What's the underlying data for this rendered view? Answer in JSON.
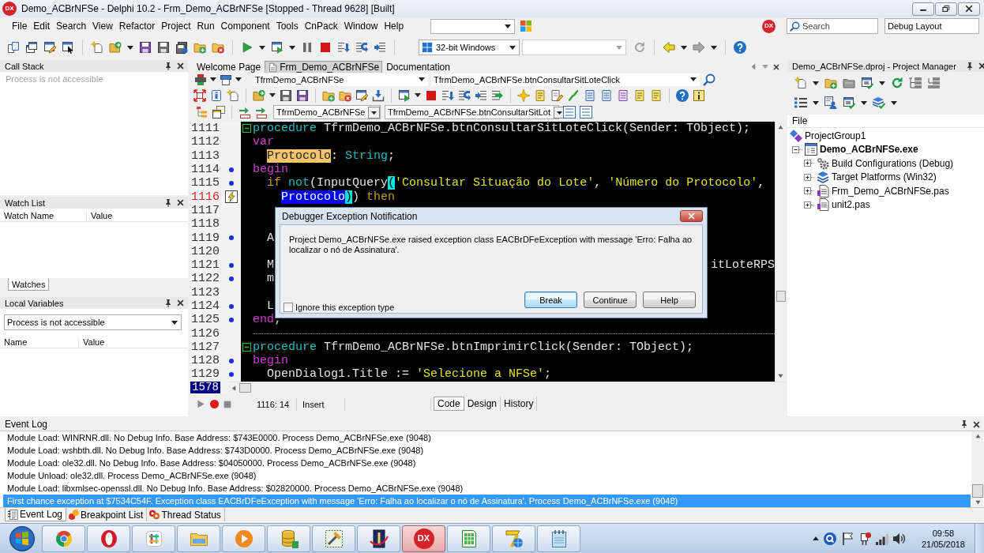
{
  "title_bar": {
    "logo": "DX",
    "title": "Demo_ACBrNFSe - Delphi 10.2 - Frm_Demo_ACBrNFSe [Stopped - Thread 9628] [Built]"
  },
  "menu_bar": {
    "items": [
      "File",
      "Edit",
      "Search",
      "View",
      "Refactor",
      "Project",
      "Run",
      "Component",
      "Tools",
      "CnPack",
      "Window",
      "Help"
    ],
    "logo": "DX",
    "search": {
      "placeholder": "Search"
    },
    "layout": "Debug Layout"
  },
  "toolbar": {
    "platform": "32-bit Windows"
  },
  "call_stack": {
    "title": "Call Stack",
    "message": "Process is not accessible"
  },
  "watch_list": {
    "title": "Watch List",
    "columns": [
      "Watch Name",
      "Value"
    ],
    "tabs": [
      {
        "label": "Watches",
        "selected": true
      }
    ]
  },
  "local_variables": {
    "title": "Local Variables",
    "process": "Process is not accessible",
    "columns": [
      "Name",
      "Value"
    ]
  },
  "editor": {
    "tabs": [
      {
        "label": "Welcome Page",
        "selected": false
      },
      {
        "label": "Frm_Demo_ACBrNFSe",
        "selected": true
      },
      {
        "label": "Documentation",
        "selected": false
      }
    ],
    "class_box": "TfrmDemo_ACBrNFSe",
    "method_box": "TfrmDemo_ACBrNFSe.btnConsultarSitLoteClick",
    "unit_class_box": "TfrmDemo_ACBrNFSe",
    "unit_method_box": "TfrmDemo_ACBrNFSe.btnConsultarSitLot",
    "lines": [
      {
        "number": "1111",
        "kind": "code",
        "fold": true,
        "dot": false,
        "error": false,
        "segments": [
          [
            {
              "text": "procedure",
              "kind": "reserved"
            },
            {
              "text": " TfrmDemo_ACBrNFSe.btnConsultarSitLoteClick(Sender: TObject);",
              "kind": "plain"
            }
          ]
        ]
      },
      {
        "number": "1112",
        "kind": "code",
        "fold": false,
        "dot": false,
        "error": false,
        "segments": [
          [
            {
              "text": "var",
              "kind": "block"
            }
          ]
        ]
      },
      {
        "number": "1113",
        "kind": "code",
        "fold": false,
        "dot": false,
        "error": false,
        "segments": [
          [
            {
              "text": "  Protocolo",
              "kind": "highlight"
            },
            {
              "text": ": ",
              "kind": "plain"
            },
            {
              "text": "String",
              "kind": "reserved"
            },
            {
              "text": ";",
              "kind": "plain"
            }
          ]
        ]
      },
      {
        "number": "1114",
        "kind": "code",
        "fold": false,
        "dot": true,
        "error": false,
        "segments": [
          [
            {
              "text": "begin",
              "kind": "block"
            }
          ]
        ]
      },
      {
        "number": "1115",
        "kind": "code",
        "fold": false,
        "dot": true,
        "error": false,
        "segments": [
          [
            {
              "text": "  if",
              "kind": "control"
            },
            {
              "text": " not",
              "kind": "reserved"
            },
            {
              "text": "(InputQuery",
              "kind": "plain"
            },
            {
              "text": "(",
              "kind": "brace"
            },
            {
              "text": "'Consultar Situação do Lote'",
              "kind": "string"
            },
            {
              "text": ", ",
              "kind": "plain"
            },
            {
              "text": "'Número do Protocolo'",
              "kind": "string"
            },
            {
              "text": ",",
              "kind": "plain"
            }
          ]
        ]
      },
      {
        "number": "1116",
        "kind": "code",
        "fold": false,
        "dot": false,
        "error": true,
        "segments": [
          [
            {
              "text": "    Protocolo",
              "kind": "selected"
            },
            {
              "text": ")",
              "kind": "brace"
            },
            {
              "text": ")",
              "kind": "plain"
            },
            {
              "text": " then",
              "kind": "control"
            }
          ]
        ]
      },
      {
        "number": "1117",
        "kind": "code",
        "fold": false,
        "dot": false,
        "error": false
      },
      {
        "number": "1118",
        "kind": "code",
        "fold": false,
        "dot": false,
        "error": false
      },
      {
        "number": "1119",
        "kind": "code",
        "fold": false,
        "dot": true,
        "error": false,
        "segments": [
          [
            {
              "text": "  A",
              "kind": "plain"
            }
          ]
        ]
      },
      {
        "number": "1120",
        "kind": "code",
        "fold": false,
        "dot": false,
        "error": false
      },
      {
        "number": "1121",
        "kind": "code",
        "fold": false,
        "dot": true,
        "error": false,
        "segments": [
          [
            {
              "text": "  M",
              "kind": "plain"
            }
          ],
          [
            {
              "text": "itLoteRPS",
              "kind": "plain"
            }
          ]
        ]
      },
      {
        "number": "1122",
        "kind": "code",
        "fold": false,
        "dot": true,
        "error": false,
        "segments": [
          [
            {
              "text": "  m",
              "kind": "plain"
            }
          ]
        ]
      },
      {
        "number": "1123",
        "kind": "code",
        "fold": false,
        "dot": false,
        "error": false
      },
      {
        "number": "1124",
        "kind": "code",
        "fold": false,
        "dot": true,
        "error": false,
        "segments": [
          [
            {
              "text": "  L",
              "kind": "plain"
            }
          ]
        ]
      },
      {
        "number": "1125",
        "kind": "code",
        "fold": false,
        "dot": true,
        "error": false,
        "segments": [
          [
            {
              "text": "end",
              "kind": "block"
            },
            {
              "text": ";",
              "kind": "plain"
            }
          ]
        ]
      },
      {
        "number": "1126",
        "kind": "separator",
        "fold": false,
        "dot": false,
        "error": false
      },
      {
        "number": "1127",
        "kind": "code",
        "fold": true,
        "dot": false,
        "error": false,
        "segments": [
          [
            {
              "text": "procedure",
              "kind": "reserved"
            },
            {
              "text": " TfrmDemo_ACBrNFSe.btnImprimirClick(Sender: TObject);",
              "kind": "plain"
            }
          ]
        ]
      },
      {
        "number": "1128",
        "kind": "code",
        "fold": false,
        "dot": true,
        "error": false,
        "segments": [
          [
            {
              "text": "begin",
              "kind": "block"
            }
          ]
        ]
      },
      {
        "number": "1129",
        "kind": "code",
        "fold": false,
        "dot": true,
        "error": false,
        "segments": [
          [
            {
              "text": "  OpenDialog1.Title := ",
              "kind": "plain"
            },
            {
              "text": "'Selecione a NFSe'",
              "kind": "string"
            },
            {
              "text": ";",
              "kind": "plain"
            }
          ]
        ]
      }
    ],
    "line_count": "1578",
    "cursor": "1116: 14",
    "mode": "Insert",
    "view_tabs": [
      {
        "label": "Code",
        "selected": true
      },
      {
        "label": "Design",
        "selected": false
      },
      {
        "label": "History",
        "selected": false
      }
    ]
  },
  "exception_dialog": {
    "title": "Debugger Exception Notification",
    "message": "Project Demo_ACBrNFSe.exe raised exception class EACBrDFeException with message 'Erro: Falha ao localizar o nó de Assinatura'.",
    "ignore": {
      "label": "Ignore this exception type",
      "checked": false
    },
    "buttons": [
      {
        "label": "Break",
        "default": true
      },
      {
        "label": "Continue",
        "default": false
      },
      {
        "label": "Help",
        "default": false
      }
    ]
  },
  "project_manager": {
    "title": "Demo_ACBrNFSe.dproj - Project Manager",
    "column": "File",
    "tree": [
      {
        "label": "ProjectGroup1",
        "kind": "group",
        "children": [
          {
            "label": "Demo_ACBrNFSe.exe",
            "kind": "project",
            "active": true,
            "expanded": true,
            "children": [
              {
                "label": "Build Configurations (Debug)",
                "kind": "config",
                "expanded": false
              },
              {
                "label": "Target Platforms (Win32)",
                "kind": "platforms",
                "expanded": false
              },
              {
                "label": "Frm_Demo_ACBrNFSe.pas",
                "kind": "unit",
                "expanded": false
              },
              {
                "label": "unit2.pas",
                "kind": "unit",
                "expanded": false
              }
            ]
          }
        ]
      }
    ]
  },
  "event_log": {
    "title": "Event Log",
    "rows": [
      {
        "text": "Module Load: WINRNR.dll. No Debug Info. Base Address: $743E0000. Process Demo_ACBrNFSe.exe (9048)",
        "selected": false
      },
      {
        "text": "Module Load: wshbth.dll. No Debug Info. Base Address: $743D0000. Process Demo_ACBrNFSe.exe (9048)",
        "selected": false
      },
      {
        "text": "Module Load: ole32.dll. No Debug Info. Base Address: $04050000. Process Demo_ACBrNFSe.exe (9048)",
        "selected": false
      },
      {
        "text": "Module Unload: ole32.dll. Process Demo_ACBrNFSe.exe (9048)",
        "selected": false
      },
      {
        "text": "Module Load: libxmlsec-openssl.dll. No Debug Info. Base Address: $02820000. Process Demo_ACBrNFSe.exe (9048)",
        "selected": false
      },
      {
        "text": "First chance exception at $7534C54F. Exception class EACBrDFeException with message 'Erro: Falha ao localizar o nó de Assinatura'. Process Demo_ACBrNFSe.exe (9048)",
        "selected": true
      }
    ]
  },
  "bottom_tabs": [
    {
      "label": "Event Log",
      "kind": "log",
      "selected": true
    },
    {
      "label": "Breakpoint List",
      "kind": "breakpoints",
      "selected": false
    },
    {
      "label": "Thread Status",
      "kind": "threads",
      "selected": false
    }
  ],
  "taskbar": {
    "apps": [
      {
        "kind": "chrome",
        "active": false
      },
      {
        "kind": "opera",
        "active": false
      },
      {
        "kind": "slack",
        "active": false
      },
      {
        "kind": "explorer",
        "active": false
      },
      {
        "kind": "media",
        "active": false
      },
      {
        "kind": "database",
        "active": false
      },
      {
        "kind": "tools",
        "active": false
      },
      {
        "kind": "document",
        "active": false
      },
      {
        "kind": "dx",
        "text": "DX",
        "active": true
      },
      {
        "kind": "book",
        "active": false
      },
      {
        "kind": "globe",
        "active": false
      },
      {
        "kind": "notepad",
        "active": false
      }
    ],
    "time": "09:58",
    "date": "21/05/2018"
  }
}
